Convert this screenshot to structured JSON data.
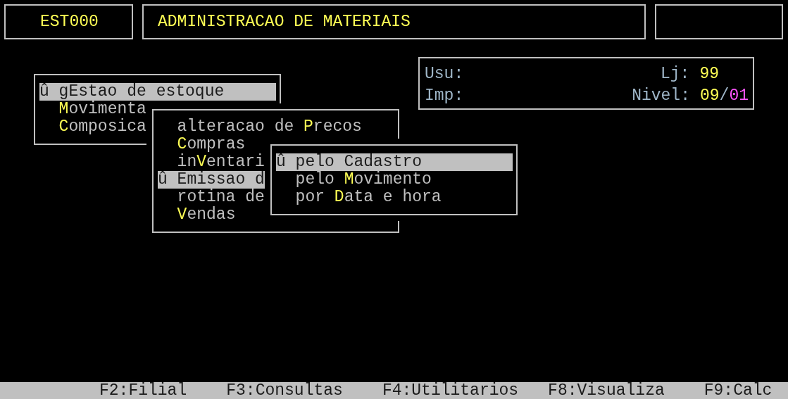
{
  "header": {
    "program_code": "EST000",
    "title": "ADMINISTRACAO DE MATERIAIS"
  },
  "info": {
    "user_label": "Usu:",
    "printer_label": "Imp:",
    "store_label": "Lj:",
    "store": "99",
    "level_label": "Nivel:",
    "level_major": "09",
    "level_separator": "/",
    "level_minor": "01"
  },
  "menus": [
    {
      "items": [
        {
          "marker": "û",
          "before": "gEstao de estoque",
          "selected": true
        },
        {
          "hotkey": "M",
          "after": "ovimenta",
          "selected": false
        },
        {
          "hotkey": "C",
          "after": "omposica",
          "selected": false
        }
      ]
    },
    {
      "items": [
        {
          "before": "alteracao de ",
          "hotkey": "P",
          "after": "recos",
          "selected": false
        },
        {
          "hotkey": "C",
          "after": "ompras",
          "selected": false
        },
        {
          "before": "in",
          "hotkey": "V",
          "after": "entari",
          "selected": false
        },
        {
          "marker": "û",
          "before": "Emissao d",
          "selected": true
        },
        {
          "before": "rotina de",
          "selected": false
        },
        {
          "hotkey": "V",
          "after": "endas",
          "selected": false
        }
      ]
    },
    {
      "items": [
        {
          "marker": "û",
          "before": "pelo Cadastro",
          "selected": true
        },
        {
          "before": "pelo ",
          "hotkey": "M",
          "after": "ovimento",
          "selected": false
        },
        {
          "before": "por ",
          "hotkey": "D",
          "after": "ata e hora",
          "selected": false
        }
      ]
    }
  ],
  "function_keys": [
    "F2:Filial",
    "F3:Consultas",
    "F4:Utilitarios",
    "F8:Visualiza",
    "F9:Calc"
  ]
}
